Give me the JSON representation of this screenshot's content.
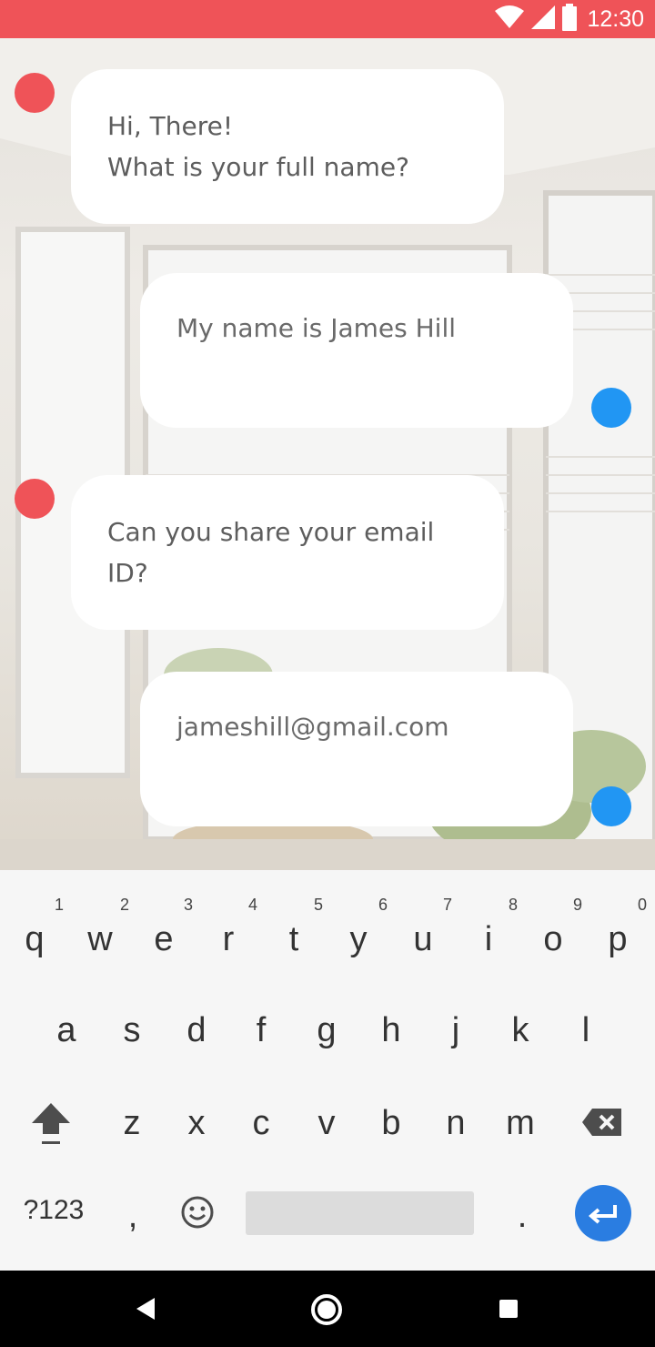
{
  "status_bar": {
    "time": "12:30",
    "icons": [
      "wifi-icon",
      "signal-icon",
      "battery-icon"
    ]
  },
  "messages": [
    {
      "from": "bot",
      "lines": [
        "Hi, There!",
        "What is your full name?"
      ]
    },
    {
      "from": "user",
      "lines": [
        "My name is James Hill"
      ]
    },
    {
      "from": "bot",
      "lines": [
        "Can you share your email",
        "ID?"
      ]
    },
    {
      "from": "user",
      "lines": [
        "jameshill@gmail.com"
      ]
    }
  ],
  "keyboard": {
    "row1": [
      {
        "key": "q",
        "hint": "1"
      },
      {
        "key": "w",
        "hint": "2"
      },
      {
        "key": "e",
        "hint": "3"
      },
      {
        "key": "r",
        "hint": "4"
      },
      {
        "key": "t",
        "hint": "5"
      },
      {
        "key": "y",
        "hint": "6"
      },
      {
        "key": "u",
        "hint": "7"
      },
      {
        "key": "i",
        "hint": "8"
      },
      {
        "key": "o",
        "hint": "9"
      },
      {
        "key": "p",
        "hint": "0"
      }
    ],
    "row2": [
      "a",
      "s",
      "d",
      "f",
      "g",
      "h",
      "j",
      "k",
      "l"
    ],
    "row3": [
      "z",
      "x",
      "c",
      "v",
      "b",
      "n",
      "m"
    ],
    "symbols_label": "?123",
    "comma": ",",
    "period": "."
  },
  "colors": {
    "accent_red": "#ef5358",
    "accent_blue": "#2196f3",
    "enter_blue": "#2a7de1"
  }
}
